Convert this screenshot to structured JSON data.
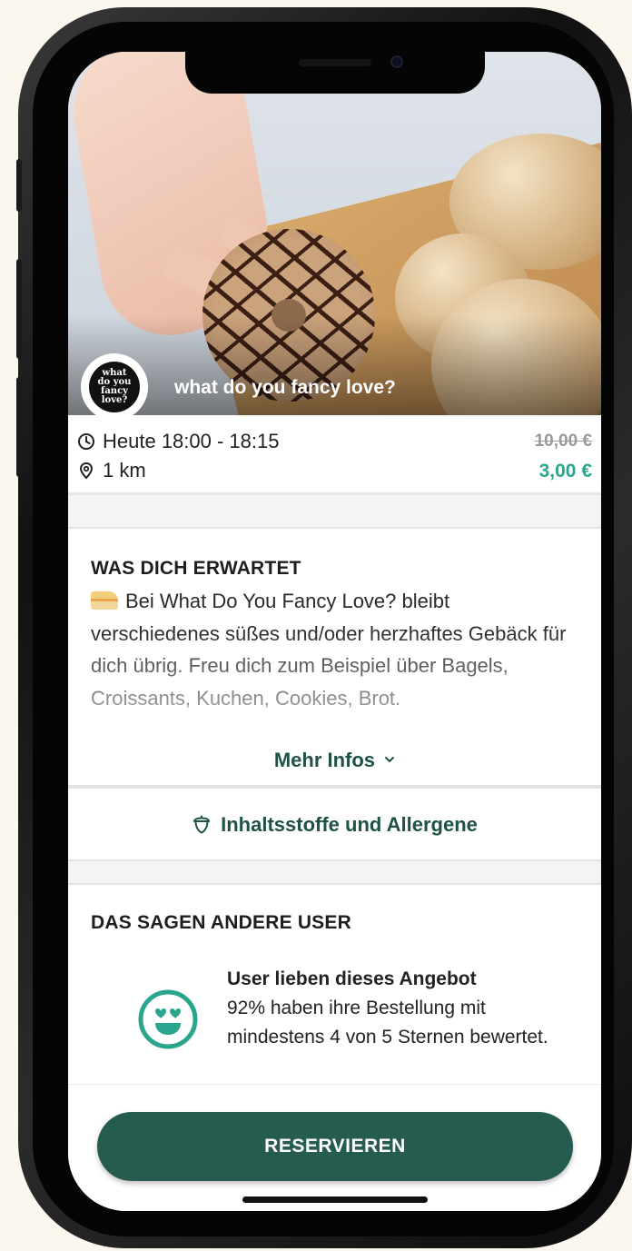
{
  "store": {
    "name": "what do you fancy love?",
    "logo_lines": [
      "what",
      "do you",
      "fancy",
      "love?"
    ]
  },
  "pickup": {
    "time": "Heute 18:00 - 18:15",
    "distance": "1 km"
  },
  "price": {
    "original": "10,00 €",
    "current": "3,00 €"
  },
  "expectation": {
    "title": "WAS DICH ERWARTET",
    "description": "Bei What Do You Fancy Love? bleibt verschiedenes süßes und/oder herzhaftes Gebäck für dich übrig. Freu dich zum Beispiel über Bagels, Croissants, Kuchen, Cookies, Brot.",
    "more_label": "Mehr Infos",
    "more_icon": "chevron-down-icon"
  },
  "allergens": {
    "label": "Inhaltsstoffe und Allergene",
    "icon": "acorn-icon"
  },
  "reviews": {
    "title": "DAS SAGEN ANDERE USER",
    "headline": "User lieben dieses Angebot",
    "text": "92% haben ihre Bestellung mit mindestens 4 von 5 Sternen bewertet.",
    "icon": "heart-eyes-smiley-icon"
  },
  "actions": {
    "reserve_label": "RESERVIEREN"
  },
  "colors": {
    "brand_dark": "#265b50",
    "brand_green_text": "#1f5147",
    "price_accent": "#2aa58e"
  }
}
